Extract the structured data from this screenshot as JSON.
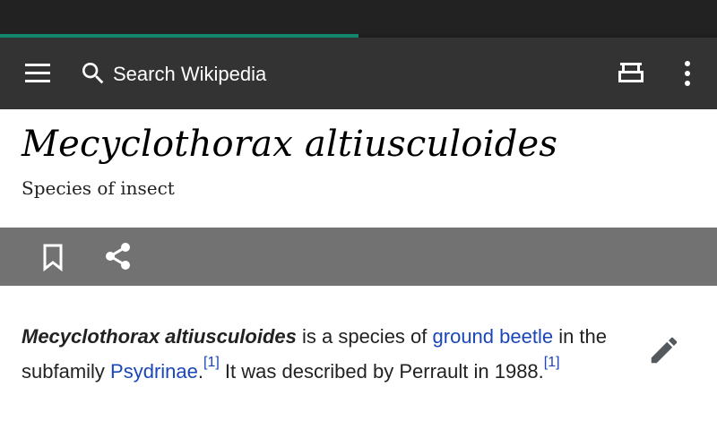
{
  "loading": {
    "progress_fraction": 0.5,
    "accent_color": "#14866d"
  },
  "toolbar": {
    "menu_icon": "menu-icon",
    "search_icon": "search-icon",
    "search_placeholder": "Search Wikipedia",
    "reader_icon": "reading-list-icon",
    "overflow_icon": "more-vertical-icon",
    "background_color": "#333333"
  },
  "article": {
    "title": "Mecyclothorax altiusculoides",
    "description": "Species of insect",
    "actions": {
      "bookmark_icon": "bookmark-icon",
      "share_icon": "share-icon",
      "bar_color": "#727272"
    },
    "edit_icon": "pencil-icon",
    "lead": {
      "bold_name": "Mecyclothorax altiusculoides",
      "text_1": " is a species of ",
      "link_1": "ground beetle",
      "text_2": " in the subfamily ",
      "link_2": "Psydrinae",
      "text_3": ".",
      "ref_1": "[1]",
      "text_4": " It was described by Perrault in 1988.",
      "ref_2": "[1]"
    },
    "link_color": "#1a46b8"
  }
}
